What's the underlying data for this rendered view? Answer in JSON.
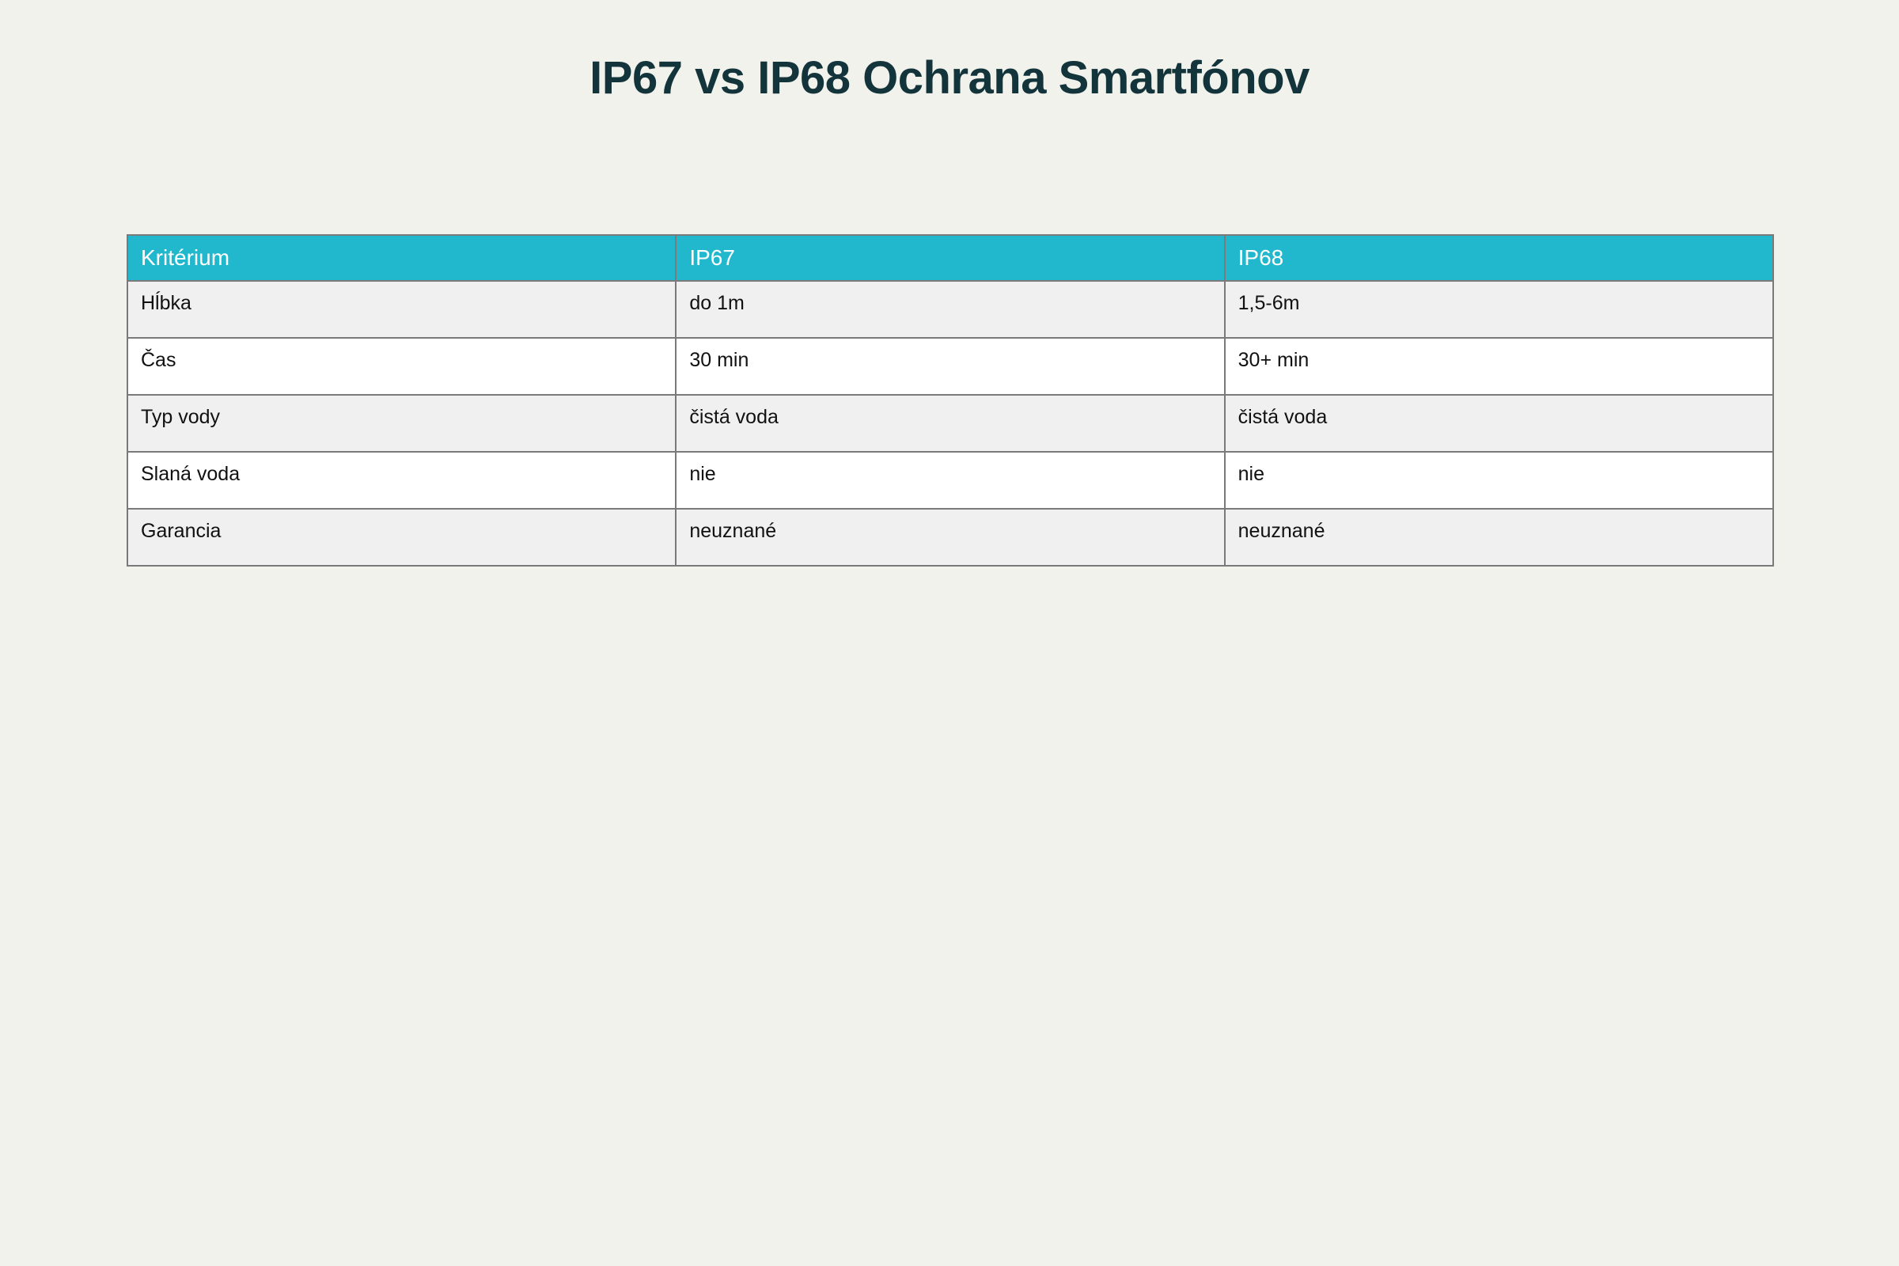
{
  "title": "IP67 vs IP68 Ochrana Smartfónov",
  "chart_data": {
    "type": "table",
    "title": "IP67 vs IP68 Ochrana Smartfónov",
    "columns": [
      "Kritérium",
      "IP67",
      "IP68"
    ],
    "rows": [
      [
        "Hĺbka",
        "do 1m",
        "1,5-6m"
      ],
      [
        "Čas",
        "30 min",
        "30+ min"
      ],
      [
        "Typ vody",
        "čistá voda",
        "čistá voda"
      ],
      [
        "Slaná voda",
        "nie",
        "nie"
      ],
      [
        "Garancia",
        "neuznané",
        "neuznané"
      ]
    ],
    "colors": {
      "header_background": "#21b8cd",
      "header_text": "#ffffff",
      "odd_row": "#f0f0f0",
      "even_row": "#ffffff",
      "title_text": "#13343b",
      "page_background": "#f2f2ed"
    }
  }
}
